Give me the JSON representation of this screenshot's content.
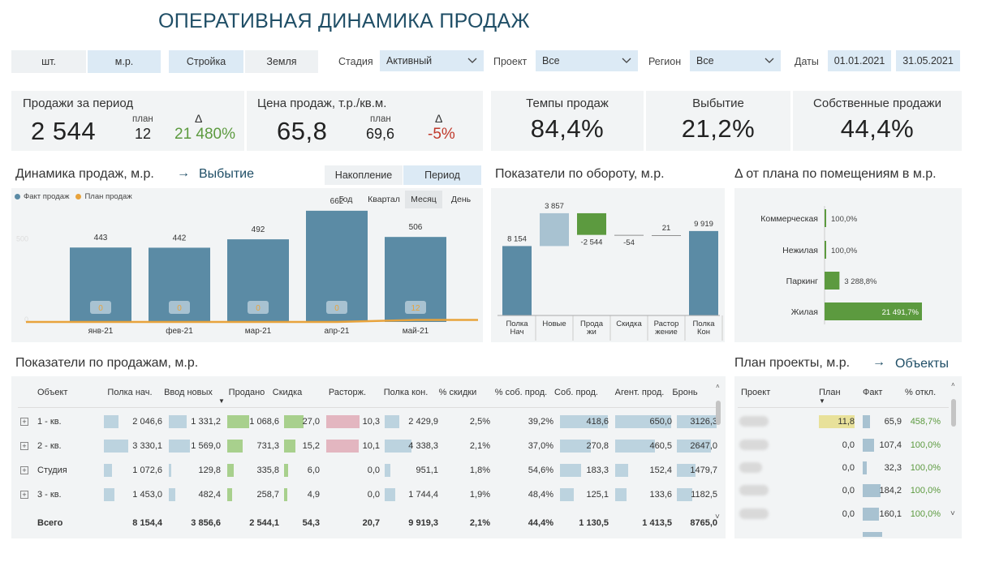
{
  "title": "ОПЕРАТИВНАЯ ДИНАМИКА ПРОДАЖ",
  "filters": {
    "unit_buttons": [
      "шт.",
      "м.р."
    ],
    "type_buttons": [
      "Стройка",
      "Земля"
    ],
    "stage_label": "Стадия",
    "stage_value": "Активный",
    "project_label": "Проект",
    "project_value": "Все",
    "region_label": "Регион",
    "region_value": "Все",
    "dates_label": "Даты",
    "date_from": "01.01.2021",
    "date_to": "31.05.2021"
  },
  "kpi": {
    "sales_label": "Продажи за период",
    "sales_value": "2 544",
    "sales_plan_label": "план",
    "sales_plan": "12",
    "sales_delta_label": "Δ",
    "sales_delta": "21 480%",
    "price_label": "Цена продаж, т.р./кв.м.",
    "price_value": "65,8",
    "price_plan_label": "план",
    "price_plan": "69,6",
    "price_delta_label": "Δ",
    "price_delta": "-5%",
    "pace_label": "Темпы продаж",
    "pace_value": "84,4%",
    "disposal_label": "Выбытие",
    "disposal_value": "21,2%",
    "own_label": "Собственные продажи",
    "own_value": "44,4%"
  },
  "dynamics": {
    "title": "Динамика продаж, м.р.",
    "arrow": "→",
    "link": "Выбытие",
    "mode_buttons": [
      "Накопление",
      "Период"
    ],
    "legend": [
      "Факт продаж",
      "План продаж"
    ],
    "period_tabs": [
      "Год",
      "Квартал",
      "Месяц",
      "День"
    ],
    "y_tick_label": "500",
    "y_zero": "0",
    "colors": {
      "fact": "#5b8ba5",
      "plan": "#e8a33c"
    }
  },
  "turnover": {
    "title": "Показатели по обороту, м.р."
  },
  "delta_plan": {
    "title": "Δ от плана по помещениям в м.р."
  },
  "sales_table": {
    "title": "Показатели по продажам, м.р.",
    "columns": [
      "Объект",
      "Полка нач.",
      "Ввод новых",
      "Продано",
      "Скидка",
      "Расторж.",
      "Полка кон.",
      "% скидки",
      "% соб. прод.",
      "Соб. прод.",
      "Агент. прод.",
      "Бронь"
    ],
    "rows": [
      {
        "name": "1 - кв.",
        "expand": "+",
        "cells": [
          "2 046,6",
          "1 331,2",
          "1 068,6",
          "27,0",
          "10,3",
          "2 429,9",
          "2,5%",
          "39,2%",
          "418,6",
          "650,0",
          "3126,3"
        ],
        "bars": [
          0.25,
          0.34,
          0.42,
          0.55,
          0.62,
          0.28,
          0,
          0,
          0.98,
          0.98,
          0.98
        ]
      },
      {
        "name": "2 - кв.",
        "expand": "+",
        "cells": [
          "3 330,1",
          "1 569,0",
          "731,3",
          "15,2",
          "10,1",
          "4 338,3",
          "2,1%",
          "37,0%",
          "270,8",
          "460,5",
          "2647,0"
        ],
        "bars": [
          0.42,
          0.4,
          0.29,
          0.31,
          0.61,
          0.5,
          0,
          0,
          0.63,
          0.7,
          0.83
        ]
      },
      {
        "name": "Студия",
        "expand": "+",
        "cells": [
          "1 072,6",
          "129,8",
          "335,8",
          "6,0",
          "0,0",
          "951,1",
          "1,8%",
          "54,6%",
          "183,3",
          "152,4",
          "1479,7"
        ],
        "bars": [
          0.14,
          0.03,
          0.13,
          0.12,
          0,
          0.11,
          0,
          0,
          0.43,
          0.23,
          0.46
        ]
      },
      {
        "name": "3 - кв.",
        "expand": "+",
        "cells": [
          "1 453,0",
          "482,4",
          "258,7",
          "4,9",
          "0,0",
          "1 744,4",
          "1,9%",
          "48,4%",
          "125,1",
          "133,6",
          "1182,5"
        ],
        "bars": [
          0.18,
          0.12,
          0.1,
          0.1,
          0,
          0.2,
          0,
          0,
          0.29,
          0.2,
          0.37
        ]
      }
    ],
    "total": [
      "Всего",
      "8 154,4",
      "3 856,6",
      "2 544,1",
      "54,3",
      "20,7",
      "9 919,3",
      "2,1%",
      "44,4%",
      "1 130,5",
      "1 413,5",
      "8765,0"
    ]
  },
  "plan_table": {
    "title": "План проекты, м.р.",
    "arrow": "→",
    "link": "Объекты",
    "columns": [
      "Проект",
      "План",
      "Факт",
      "% откл."
    ],
    "rows": [
      {
        "plan": "11,8",
        "fact": "65,9",
        "dev": "458,7%",
        "plan_bar": 1.0,
        "fact_bar": 0.05
      },
      {
        "plan": "0,0",
        "fact": "107,4",
        "dev": "100,0%",
        "plan_bar": 0,
        "fact_bar": 0.08
      },
      {
        "plan": "0,0",
        "fact": "32,3",
        "dev": "100,0%",
        "plan_bar": 0,
        "fact_bar": 0.03
      },
      {
        "plan": "0,0",
        "fact": "184,2",
        "dev": "100,0%",
        "plan_bar": 0,
        "fact_bar": 0.13
      },
      {
        "plan": "0,0",
        "fact": "160,1",
        "dev": "100,0%",
        "plan_bar": 0,
        "fact_bar": 0.12
      }
    ]
  },
  "chart_data": [
    {
      "type": "bar",
      "title": "Динамика продаж, м.р.",
      "categories": [
        "янв-21",
        "фев-21",
        "мар-21",
        "апр-21",
        "май-21"
      ],
      "series": [
        {
          "name": "Факт продаж",
          "values": [
            443,
            442,
            492,
            662,
            506
          ]
        },
        {
          "name": "План продаж",
          "values": [
            0,
            0,
            0,
            0,
            12
          ]
        }
      ],
      "ylim": [
        0,
        700
      ]
    },
    {
      "type": "bar",
      "title": "Показатели по обороту, м.р.",
      "categories": [
        "Полка Нач",
        "Новые",
        "Прода жи",
        "Скидка",
        "Растор жение",
        "Полка Кон"
      ],
      "values": [
        8154,
        3857,
        -2544,
        -54,
        21,
        9919
      ],
      "labels": [
        "8 154",
        "3 857",
        "-2 544",
        "-54",
        "21",
        "9 919"
      ],
      "subtype": "waterfall"
    },
    {
      "type": "bar",
      "title": "Δ от плана по помещениям в м.р.",
      "categories": [
        "Коммерческая",
        "Нежилая",
        "Паркинг",
        "Жилая"
      ],
      "values": [
        100.0,
        100.0,
        3288.8,
        21491.7
      ],
      "labels": [
        "100,0%",
        "100,0%",
        "3 288,8%",
        "21 491,7%"
      ],
      "orientation": "horizontal"
    }
  ]
}
